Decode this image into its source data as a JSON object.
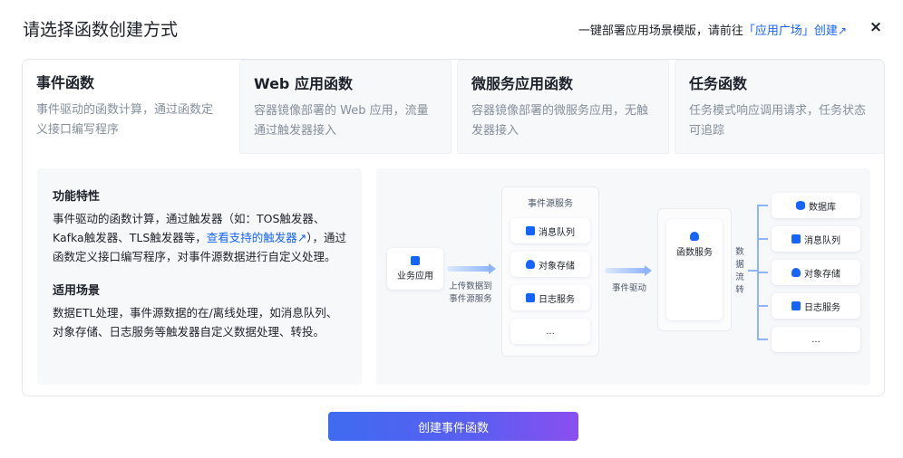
{
  "header": {
    "title": "请选择函数创建方式",
    "right_text": "一键部署应用场景模版，请前往",
    "right_link": "「应用广场」创建",
    "right_arrow": "↗",
    "close": "×"
  },
  "tabs": [
    {
      "title": "事件函数",
      "desc": "事件驱动的函数计算，通过函数定义接口编写程序",
      "active": true
    },
    {
      "title": "Web 应用函数",
      "desc": "容器镜像部署的 Web 应用，流量通过触发器接入",
      "active": false
    },
    {
      "title": "微服务应用函数",
      "desc": "容器镜像部署的微服务应用，无触发器接入",
      "active": false
    },
    {
      "title": "任务函数",
      "desc": "任务模式响应调用请求，任务状态可追踪",
      "active": false
    }
  ],
  "info": {
    "features_title": "功能特性",
    "features_text_1": "事件驱动的函数计算，通过触发器（如：TOS触发器、Kafka触发器、TLS触发器等，",
    "features_link": "查看支持的触发器",
    "features_link_icon": "↗",
    "features_text_2": "），通过函数定义接口编写程序，对事件源数据进行自定义处理。",
    "scenarios_title": "适用场景",
    "scenarios_text": "数据ETL处理，事件源数据的在/离线处理，如消息队列、对象存储、日志服务等触发器自定义数据处理、转投。"
  },
  "diagram": {
    "business_app": "业务应用",
    "upload_label": "上传数据到事件源服务",
    "event_source_title": "事件源服务",
    "sources": [
      "消息队列",
      "对象存储",
      "日志服务",
      "..."
    ],
    "event_driven": "事件驱动",
    "function_service": "函数服务",
    "data_flow": "数据流转",
    "targets": [
      "数据库",
      "消息队列",
      "对象存储",
      "日志服务",
      "..."
    ]
  },
  "footer": {
    "create_button": "创建事件函数"
  },
  "colors": {
    "accent": "#1664ff",
    "button_gradient_start": "#3f6bf0",
    "button_gradient_end": "#8a4ff0"
  }
}
